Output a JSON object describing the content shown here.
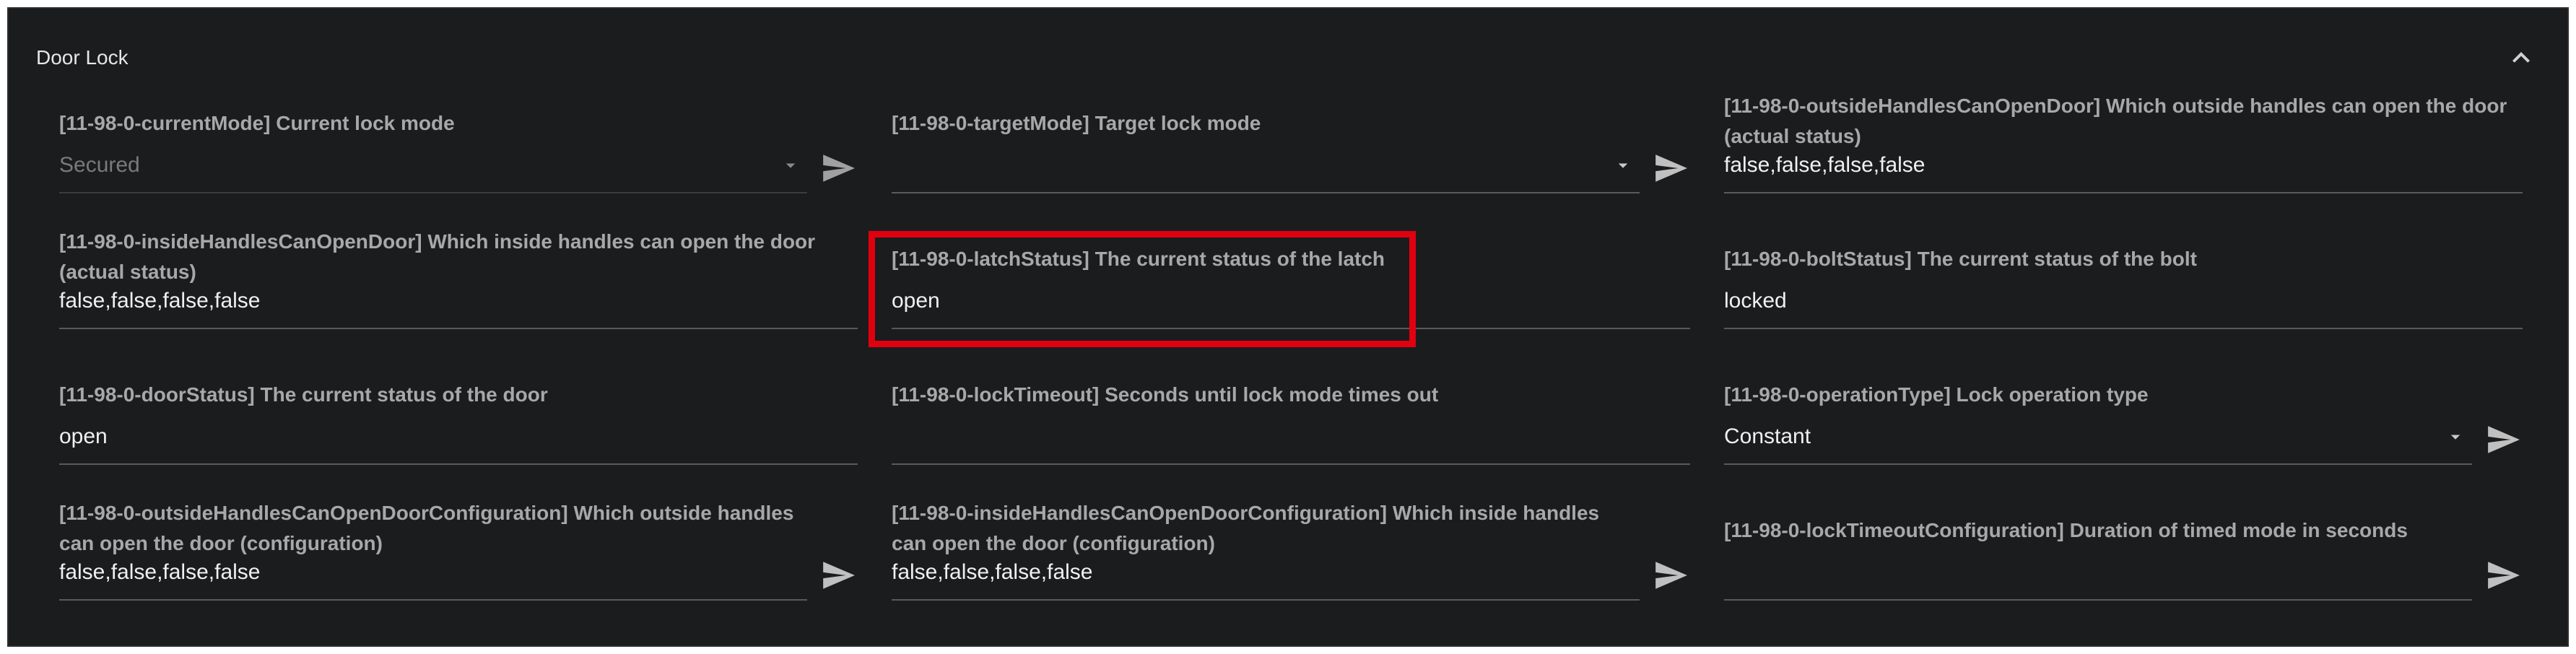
{
  "panel": {
    "title": "Door Lock"
  },
  "fields": {
    "currentMode": {
      "label": "[11-98-0-currentMode] Current lock mode",
      "value": "Secured"
    },
    "targetMode": {
      "label": "[11-98-0-targetMode] Target lock mode",
      "value": ""
    },
    "outsideHandlesCanOpenDoor": {
      "label": "[11-98-0-outsideHandlesCanOpenDoor] Which outside handles can open the door (actual status)",
      "value": "false,false,false,false"
    },
    "insideHandlesCanOpenDoor": {
      "label": "[11-98-0-insideHandlesCanOpenDoor] Which inside handles can open the door (actual status)",
      "value": "false,false,false,false"
    },
    "latchStatus": {
      "label": "[11-98-0-latchStatus] The current status of the latch",
      "value": "open"
    },
    "boltStatus": {
      "label": "[11-98-0-boltStatus] The current status of the bolt",
      "value": "locked"
    },
    "doorStatus": {
      "label": "[11-98-0-doorStatus] The current status of the door",
      "value": "open"
    },
    "lockTimeout": {
      "label": "[11-98-0-lockTimeout] Seconds until lock mode times out",
      "value": ""
    },
    "operationType": {
      "label": "[11-98-0-operationType] Lock operation type",
      "value": "Constant"
    },
    "outsideHandlesCanOpenDoorConfiguration": {
      "label": "[11-98-0-outsideHandlesCanOpenDoorConfiguration] Which outside handles can open the door (configuration)",
      "value": "false,false,false,false"
    },
    "insideHandlesCanOpenDoorConfiguration": {
      "label": "[11-98-0-insideHandlesCanOpenDoorConfiguration] Which inside handles can open the door (configuration)",
      "value": "false,false,false,false"
    },
    "lockTimeoutConfiguration": {
      "label": "[11-98-0-lockTimeoutConfiguration] Duration of timed mode in seconds",
      "value": ""
    }
  },
  "icons": {
    "collapse": "chevron-up-icon",
    "dropdown": "arrow-drop-down-icon",
    "send": "send-icon"
  },
  "colors": {
    "panel_background": "#1b1c1e",
    "highlight": "#e1000f",
    "label": "#a8a8a8",
    "value": "#f0f0f0"
  }
}
